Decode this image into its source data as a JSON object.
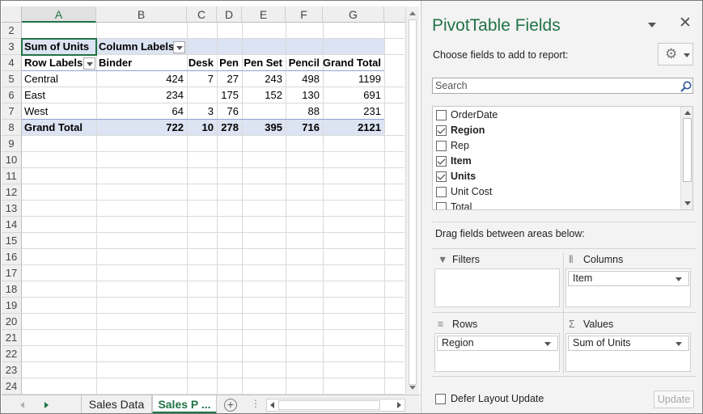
{
  "sheet": {
    "columns": [
      "A",
      "B",
      "C",
      "D",
      "E",
      "F",
      "G"
    ],
    "rows": [
      "2",
      "3",
      "4",
      "5",
      "6",
      "7",
      "8",
      "9",
      "10",
      "11",
      "12",
      "13",
      "14",
      "15",
      "16",
      "17",
      "18",
      "19",
      "20",
      "21",
      "22",
      "23",
      "24"
    ],
    "pivot": {
      "sum_label": "Sum of Units",
      "column_labels": "Column Labels",
      "row_labels": "Row Labels",
      "headers": [
        "Binder",
        "Desk",
        "Pen",
        "Pen Set",
        "Pencil",
        "Grand Total"
      ],
      "data": [
        {
          "label": "Central",
          "values": [
            "424",
            "7",
            "27",
            "243",
            "498",
            "1199"
          ]
        },
        {
          "label": "East",
          "values": [
            "234",
            "",
            "175",
            "152",
            "130",
            "691"
          ]
        },
        {
          "label": "West",
          "values": [
            "64",
            "3",
            "76",
            "",
            "88",
            "231"
          ]
        }
      ],
      "total": {
        "label": "Grand Total",
        "values": [
          "722",
          "10",
          "278",
          "395",
          "716",
          "2121"
        ]
      }
    }
  },
  "tabs": {
    "items": [
      {
        "label": "Sales Data",
        "active": false
      },
      {
        "label": "Sales P ...",
        "active": true
      }
    ],
    "add_symbol": "+",
    "dots": "⋮"
  },
  "pane": {
    "title": "PivotTable Fields",
    "close": "✕",
    "choose": "Choose fields to add to report:",
    "gear_icon": "⚙",
    "search_placeholder": "Search",
    "fields": [
      {
        "name": "OrderDate",
        "checked": false
      },
      {
        "name": "Region",
        "checked": true
      },
      {
        "name": "Rep",
        "checked": false
      },
      {
        "name": "Item",
        "checked": true
      },
      {
        "name": "Units",
        "checked": true
      },
      {
        "name": "Unit Cost",
        "checked": false
      },
      {
        "name": "Total",
        "checked": false
      }
    ],
    "drag_label": "Drag fields between areas below:",
    "areas": {
      "filters": {
        "label": "Filters",
        "icon": "▼",
        "items": []
      },
      "columns": {
        "label": "Columns",
        "icon": "⦀",
        "items": [
          "Item"
        ]
      },
      "rows": {
        "label": "Rows",
        "icon": "≡",
        "items": [
          "Region"
        ]
      },
      "values": {
        "label": "Values",
        "icon": "Σ",
        "items": [
          "Sum of Units"
        ]
      }
    },
    "defer_label": "Defer Layout Update",
    "update_label": "Update"
  },
  "colors": {
    "accent": "#217346",
    "pivot_band": "#dce3f2",
    "pivot_line": "#8ea3cf"
  }
}
